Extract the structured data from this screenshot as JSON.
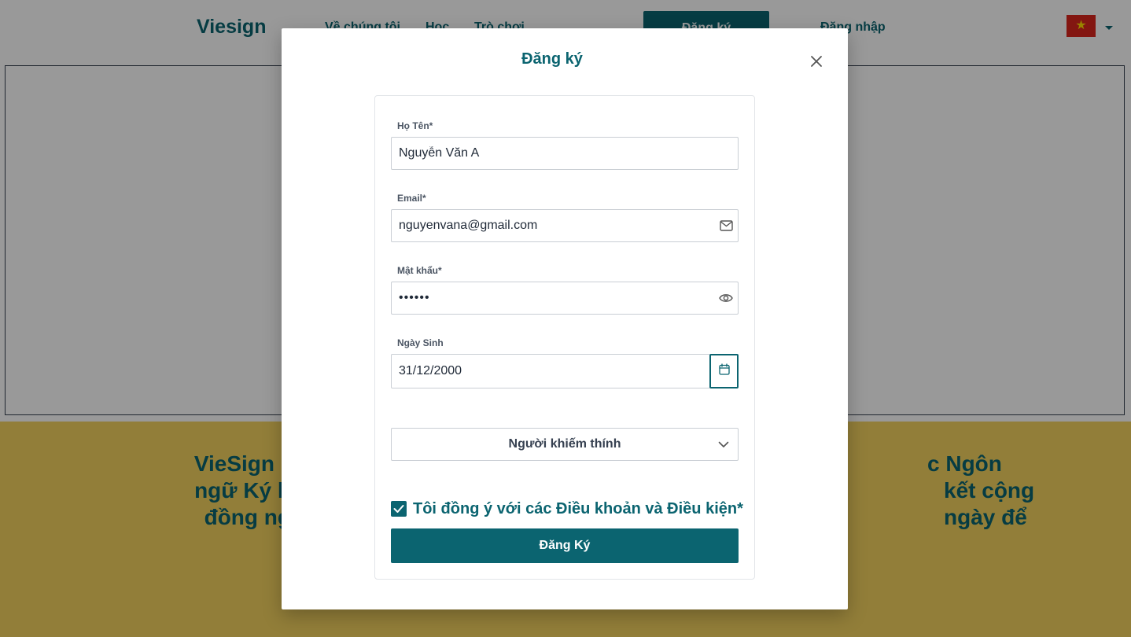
{
  "nav": {
    "logo": "Viesign",
    "links": [
      "Về chúng tôi",
      "Học",
      "Trò chơi"
    ],
    "register_label": "Đăng ký",
    "login_label": "Đăng nhập",
    "language_flag_icon": "vietnam-flag-icon"
  },
  "hero": {
    "lines": [
      "VieSign ... các Ngôn",
      "ngữ Ký h... kết cộng",
      "đồng ng... ngày để"
    ],
    "colors": {
      "background": "#f3d25f",
      "text": "#0b6470"
    }
  },
  "modal": {
    "title": "Đăng ký",
    "close_icon": "close-icon",
    "fields": {
      "name": {
        "label": "Họ Tên*",
        "value": "Nguyễn Văn A"
      },
      "email": {
        "label": "Email*",
        "value": "nguyenvana@gmail.com",
        "icon": "mail-icon"
      },
      "password": {
        "label": "Mật khẩu*",
        "value": "••••••",
        "icon": "eye-icon"
      },
      "birthdate": {
        "label": "Ngày Sinh",
        "value": "31/12/2000",
        "icon": "calendar-icon"
      }
    },
    "role_select": {
      "value": "Người khiếm thính",
      "icon": "chevron-down-icon"
    },
    "agree": {
      "checked": true,
      "text": "Tôi đồng ý với các Điều khoản và Điều kiện*"
    },
    "submit_label": "Đăng Ký"
  },
  "colors": {
    "accent": "#0b6470",
    "overlay": "rgba(0,0,0,0.40)"
  }
}
